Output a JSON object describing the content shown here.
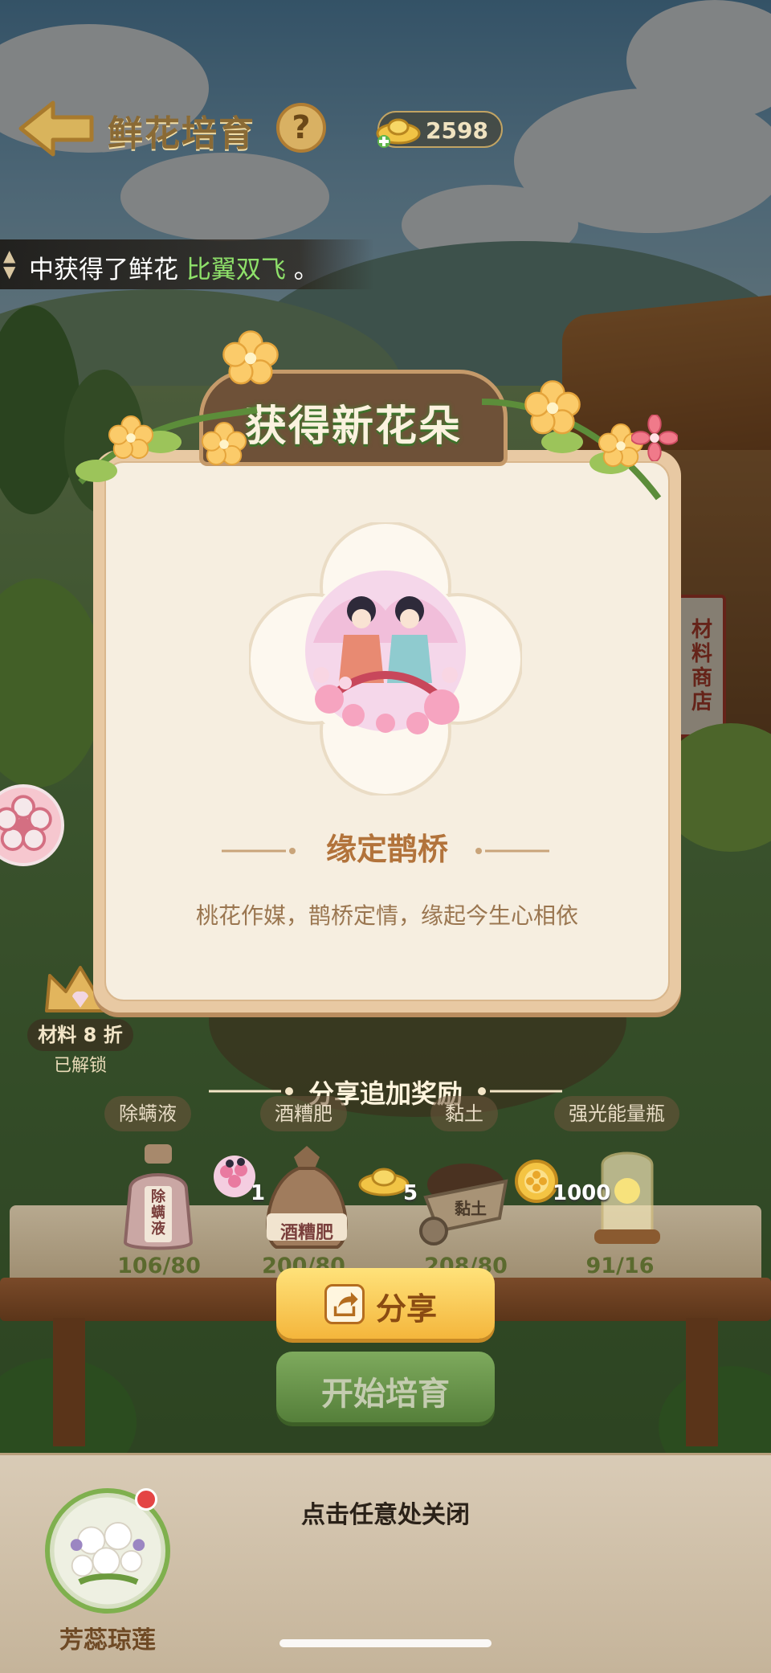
{
  "header": {
    "title": "鲜花培育",
    "help_label": "?",
    "ingot_count": "2598"
  },
  "notice": {
    "prefix": "中获得了鲜花 ",
    "flower": "比翼双飞",
    "suffix": " 。"
  },
  "shop_sign": "材料商店",
  "discount": {
    "label": "材料 8 折",
    "status": "已解锁"
  },
  "popup": {
    "title": "获得新花朵",
    "flower_name": "缘定鹊桥",
    "description": "桃花作媒，鹊桥定情，缘起今生心相依"
  },
  "share_reward": {
    "title": "分享追加奖励",
    "rewards": [
      {
        "icon": "flower-bouquet-icon",
        "qty": "1"
      },
      {
        "icon": "gold-ingot-icon",
        "qty": "5"
      },
      {
        "icon": "gold-coin-icon",
        "qty": "1000"
      }
    ]
  },
  "materials": [
    {
      "name": "除螨液",
      "icon": "mite-liquid-bottle-icon",
      "bottle_text": "除螨液",
      "count": "106/80"
    },
    {
      "name": "酒糟肥",
      "icon": "fertilizer-bag-icon",
      "bottle_text": "酒糟肥",
      "count": "200/80"
    },
    {
      "name": "黏土",
      "icon": "clay-cart-icon",
      "bottle_text": "黏土",
      "count": "208/80"
    },
    {
      "name": "强光能量瓶",
      "icon": "light-energy-jar-icon",
      "bottle_text": "",
      "count": "91/16"
    }
  ],
  "buttons": {
    "share": "分享",
    "start": "开始培育"
  },
  "close_hint": "点击任意处关闭",
  "bottom_flower_name": "芳蕊琼莲",
  "colors": {
    "title_green": "#3f7a2f",
    "share_yellow": "#f4b63c",
    "notice_flower_green": "#8ee06a",
    "name_brown": "#b2733b"
  }
}
